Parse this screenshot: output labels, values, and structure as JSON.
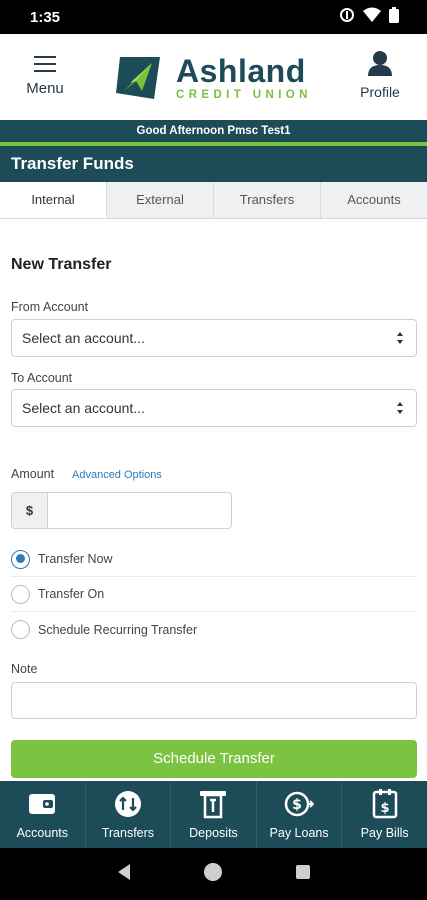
{
  "status_bar": {
    "time": "1:35"
  },
  "header": {
    "menu_label": "Menu",
    "profile_label": "Profile",
    "logo_name": "Ashland",
    "logo_subtitle": "CREDIT UNION"
  },
  "greeting": "Good Afternoon Pmsc Test1",
  "page_title": "Transfer Funds",
  "tabs": [
    {
      "label": "Internal",
      "active": true
    },
    {
      "label": "External",
      "active": false
    },
    {
      "label": "Transfers",
      "active": false
    },
    {
      "label": "Accounts",
      "active": false
    }
  ],
  "form": {
    "section_title": "New Transfer",
    "from_label": "From Account",
    "from_value": "Select an account...",
    "to_label": "To Account",
    "to_value": "Select an account...",
    "amount_label": "Amount",
    "advanced_options": "Advanced Options",
    "currency_symbol": "$",
    "amount_value": "",
    "options": [
      {
        "label": "Transfer Now",
        "checked": true
      },
      {
        "label": "Transfer On",
        "checked": false
      },
      {
        "label": "Schedule Recurring Transfer",
        "checked": false
      }
    ],
    "note_label": "Note",
    "note_value": "",
    "submit_label": "Schedule Transfer"
  },
  "bottom_nav": [
    {
      "label": "Accounts",
      "icon": "wallet-icon"
    },
    {
      "label": "Transfers",
      "icon": "transfer-arrows-icon"
    },
    {
      "label": "Deposits",
      "icon": "deposit-check-icon"
    },
    {
      "label": "Pay Loans",
      "icon": "pay-loans-icon"
    },
    {
      "label": "Pay Bills",
      "icon": "pay-bills-icon"
    }
  ],
  "colors": {
    "brand_dark": "#1d4b57",
    "brand_green": "#79c23c",
    "link_blue": "#2b7bb9"
  }
}
